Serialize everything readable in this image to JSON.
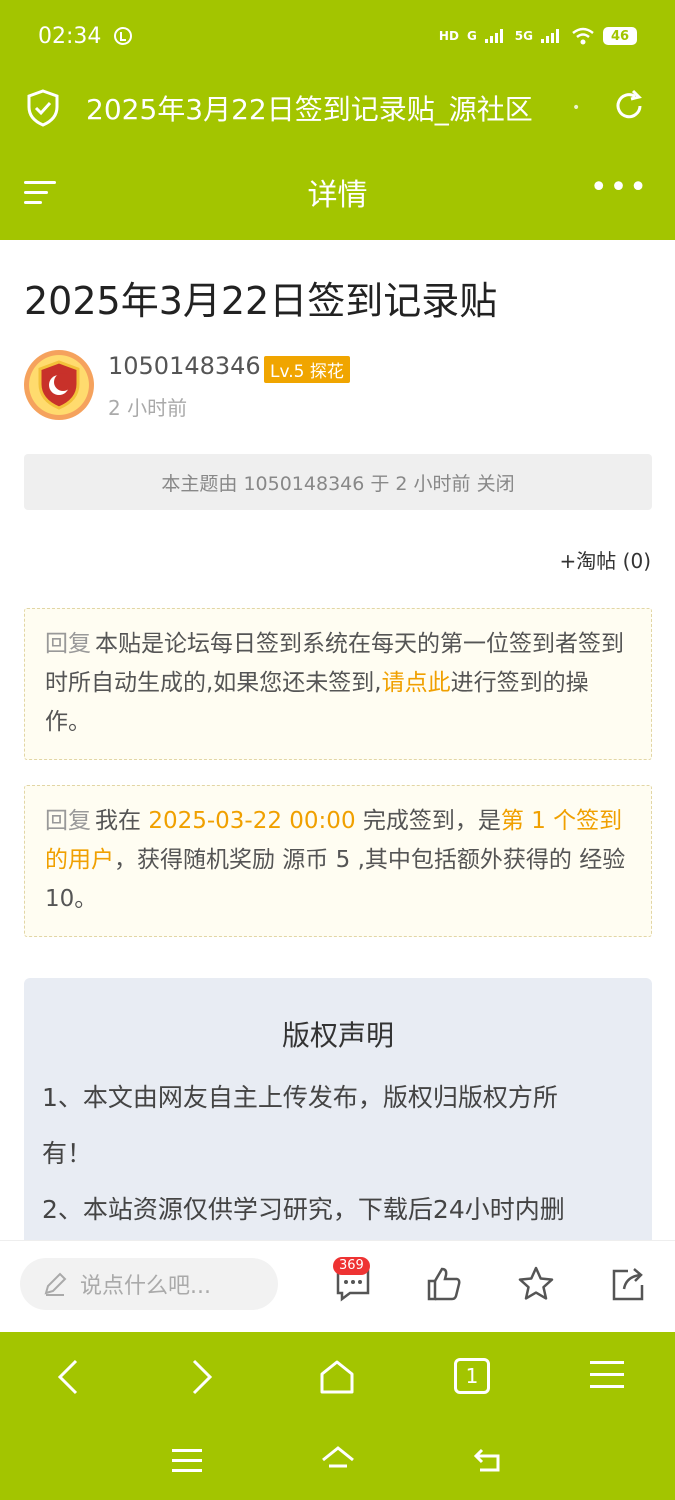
{
  "status": {
    "time": "02:34",
    "hd": "HD",
    "sig1": "G",
    "sig2": "5G",
    "battery": "46"
  },
  "url_bar": {
    "title": "2025年3月22日签到记录贴_源社区"
  },
  "nav": {
    "title": "详情"
  },
  "post": {
    "title": "2025年3月22日签到记录贴",
    "author": "1050148346",
    "level_badge": "Lv.5 探花",
    "time": "2 小时前",
    "closed_notice": "本主题由 1050148346 于 2 小时前 关闭",
    "taotie": "+淘帖 (0)"
  },
  "reply1": {
    "label": "回复",
    "text_a": "本贴是论坛每日签到系统在每天的第一位签到者签到时所自动生成的,如果您还未签到,",
    "link": "请点此",
    "text_b": "进行签到的操作。"
  },
  "reply2": {
    "label": "回复",
    "text_a": "我在 ",
    "date": "2025-03-22 00:00",
    "text_b": " 完成签到，是",
    "rank": "第 1 个签到的用户",
    "text_c": "，获得随机奖励 源币 5 ,其中包括额外获得的 经验10。"
  },
  "copyright": {
    "title": "版权声明",
    "line1a": "1、本文由网友自主上传发布，版权归版权方所",
    "line1b": "有！",
    "line2": "2、本站资源仅供学习研究，下载后24小时内删"
  },
  "actions": {
    "comment_placeholder": "说点什么吧...",
    "comment_count": "369"
  },
  "bottom_nav": {
    "tab_count": "1"
  },
  "colors": {
    "brand": "#a3c500",
    "accent": "#f0a000",
    "badge": "#ee3333"
  }
}
